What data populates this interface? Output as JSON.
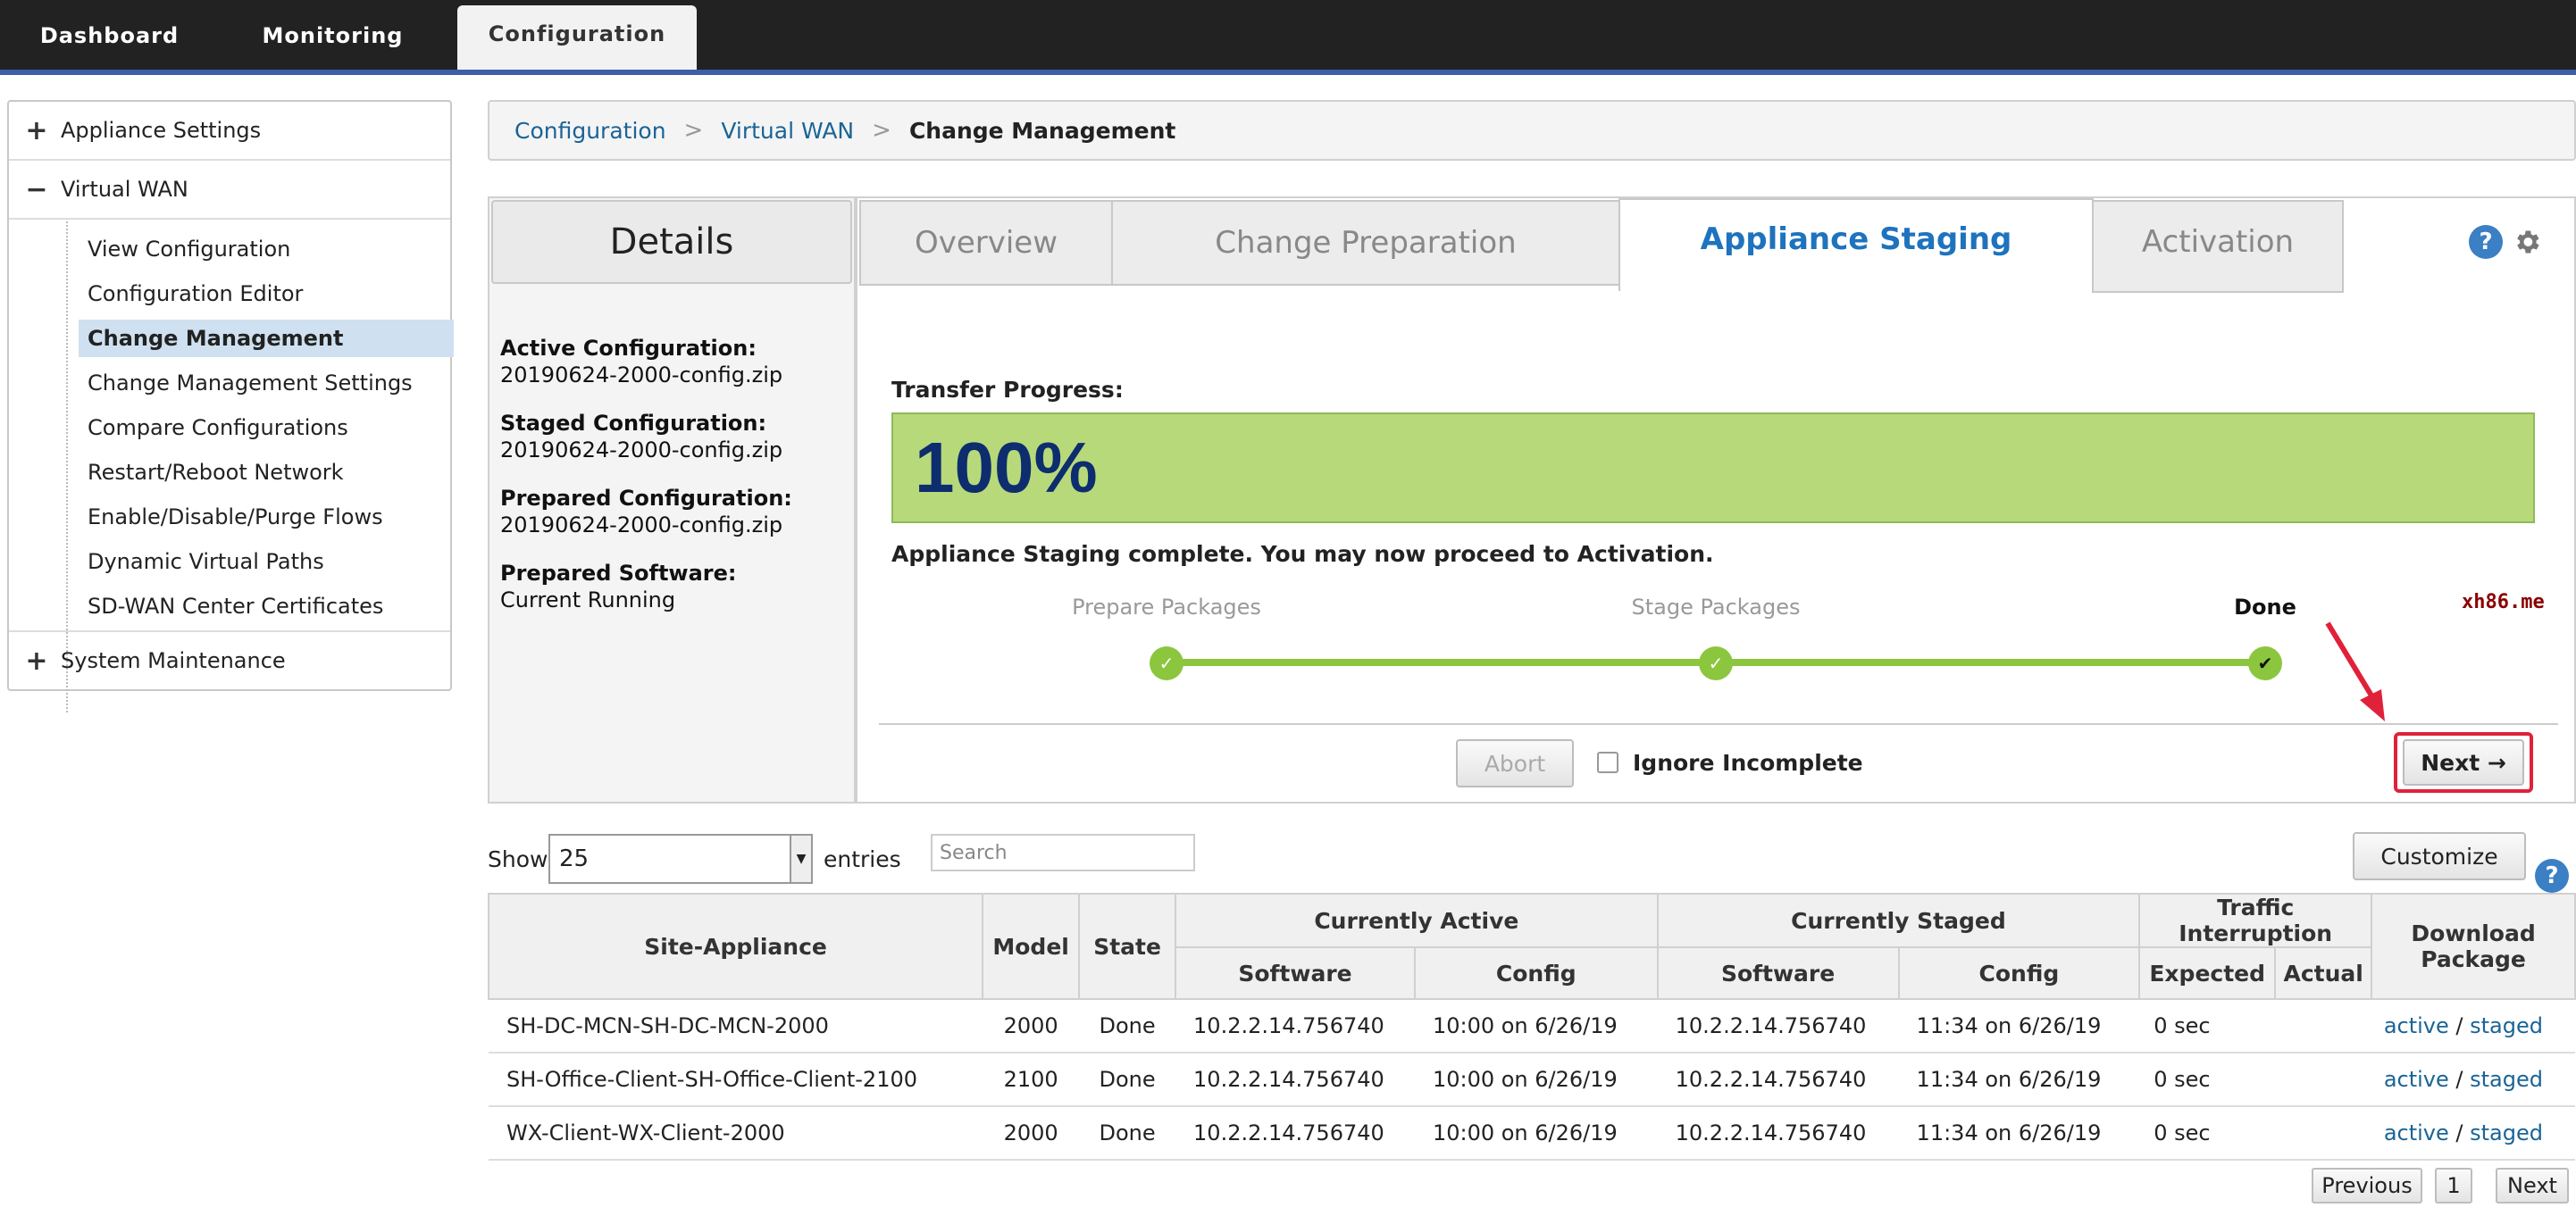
{
  "topnav": {
    "tabs": [
      {
        "label": "Dashboard"
      },
      {
        "label": "Monitoring"
      },
      {
        "label": "Configuration"
      }
    ]
  },
  "sidebar": {
    "groups": [
      {
        "toggle": "+",
        "label": "Appliance Settings"
      },
      {
        "toggle": "−",
        "label": "Virtual WAN"
      },
      {
        "toggle": "+",
        "label": "System Maintenance"
      }
    ],
    "items": [
      {
        "label": "View Configuration"
      },
      {
        "label": "Configuration Editor"
      },
      {
        "label": "Change Management"
      },
      {
        "label": "Change Management Settings"
      },
      {
        "label": "Compare Configurations"
      },
      {
        "label": "Restart/Reboot Network"
      },
      {
        "label": "Enable/Disable/Purge Flows"
      },
      {
        "label": "Dynamic Virtual Paths"
      },
      {
        "label": "SD-WAN Center Certificates"
      }
    ]
  },
  "breadcrumb": {
    "items": [
      "Configuration",
      "Virtual WAN",
      "Change Management"
    ],
    "sep": ">"
  },
  "details": {
    "title": "Details",
    "fields": [
      {
        "label": "Active Configuration:",
        "value": "20190624-2000-config.zip"
      },
      {
        "label": "Staged Configuration:",
        "value": "20190624-2000-config.zip"
      },
      {
        "label": "Prepared Configuration:",
        "value": "20190624-2000-config.zip"
      },
      {
        "label": "Prepared Software:",
        "value": "Current Running"
      }
    ]
  },
  "wizard": {
    "tabs": [
      {
        "label": "Overview"
      },
      {
        "label": "Change Preparation"
      },
      {
        "label": "Appliance Staging"
      },
      {
        "label": "Activation"
      }
    ],
    "help_label": "?",
    "transfer_label": "Transfer Progress:",
    "progress_text": "100%",
    "progress_value": 100,
    "message": "Appliance Staging complete. You may now proceed to Activation.",
    "steps": [
      {
        "label": "Prepare Packages",
        "status": "complete",
        "mark": "✓"
      },
      {
        "label": "Stage Packages",
        "status": "complete",
        "mark": "✓"
      },
      {
        "label": "Done",
        "status": "current",
        "mark": "✔"
      }
    ],
    "watermark": "xh86.me",
    "abort_label": "Abort",
    "ignore_label": "Ignore Incomplete",
    "next_label": "Next →"
  },
  "table_controls": {
    "show_label": "Show",
    "entries_value": "25",
    "entries_label": "entries",
    "search_placeholder": "Search",
    "customize_label": "Customize",
    "help_label": "?"
  },
  "table": {
    "headers": {
      "site": "Site-Appliance",
      "model": "Model",
      "state": "State",
      "currently_active": "Currently Active",
      "currently_staged": "Currently Staged",
      "traffic_interruption": "Traffic Interruption",
      "download": "Download Package",
      "software": "Software",
      "config": "Config",
      "expected": "Expected",
      "actual": "Actual"
    },
    "rows": [
      {
        "site": "SH-DC-MCN-SH-DC-MCN-2000",
        "model": "2000",
        "state": "Done",
        "active_sw": "10.2.2.14.756740",
        "active_cfg": "10:00 on 6/26/19",
        "staged_sw": "10.2.2.14.756740",
        "staged_cfg": "11:34 on 6/26/19",
        "expected": "0 sec",
        "actual": "",
        "dl_active": "active",
        "dl_sep": "/",
        "dl_staged": "staged"
      },
      {
        "site": "SH-Office-Client-SH-Office-Client-2100",
        "model": "2100",
        "state": "Done",
        "active_sw": "10.2.2.14.756740",
        "active_cfg": "10:00 on 6/26/19",
        "staged_sw": "10.2.2.14.756740",
        "staged_cfg": "11:34 on 6/26/19",
        "expected": "0 sec",
        "actual": "",
        "dl_active": "active",
        "dl_sep": "/",
        "dl_staged": "staged"
      },
      {
        "site": "WX-Client-WX-Client-2000",
        "model": "2000",
        "state": "Done",
        "active_sw": "10.2.2.14.756740",
        "active_cfg": "10:00 on 6/26/19",
        "staged_sw": "10.2.2.14.756740",
        "staged_cfg": "11:34 on 6/26/19",
        "expected": "0 sec",
        "actual": "",
        "dl_active": "active",
        "dl_sep": "/",
        "dl_staged": "staged"
      }
    ]
  },
  "pager": {
    "previous_label": "Previous",
    "page": "1",
    "next_label": "Next"
  },
  "colors": {
    "progress_fill": "#b7d97a",
    "step_green": "#8cc63f",
    "active_tab_text": "#1e73be",
    "link": "#1a6496",
    "highlight": "#e0213a"
  }
}
